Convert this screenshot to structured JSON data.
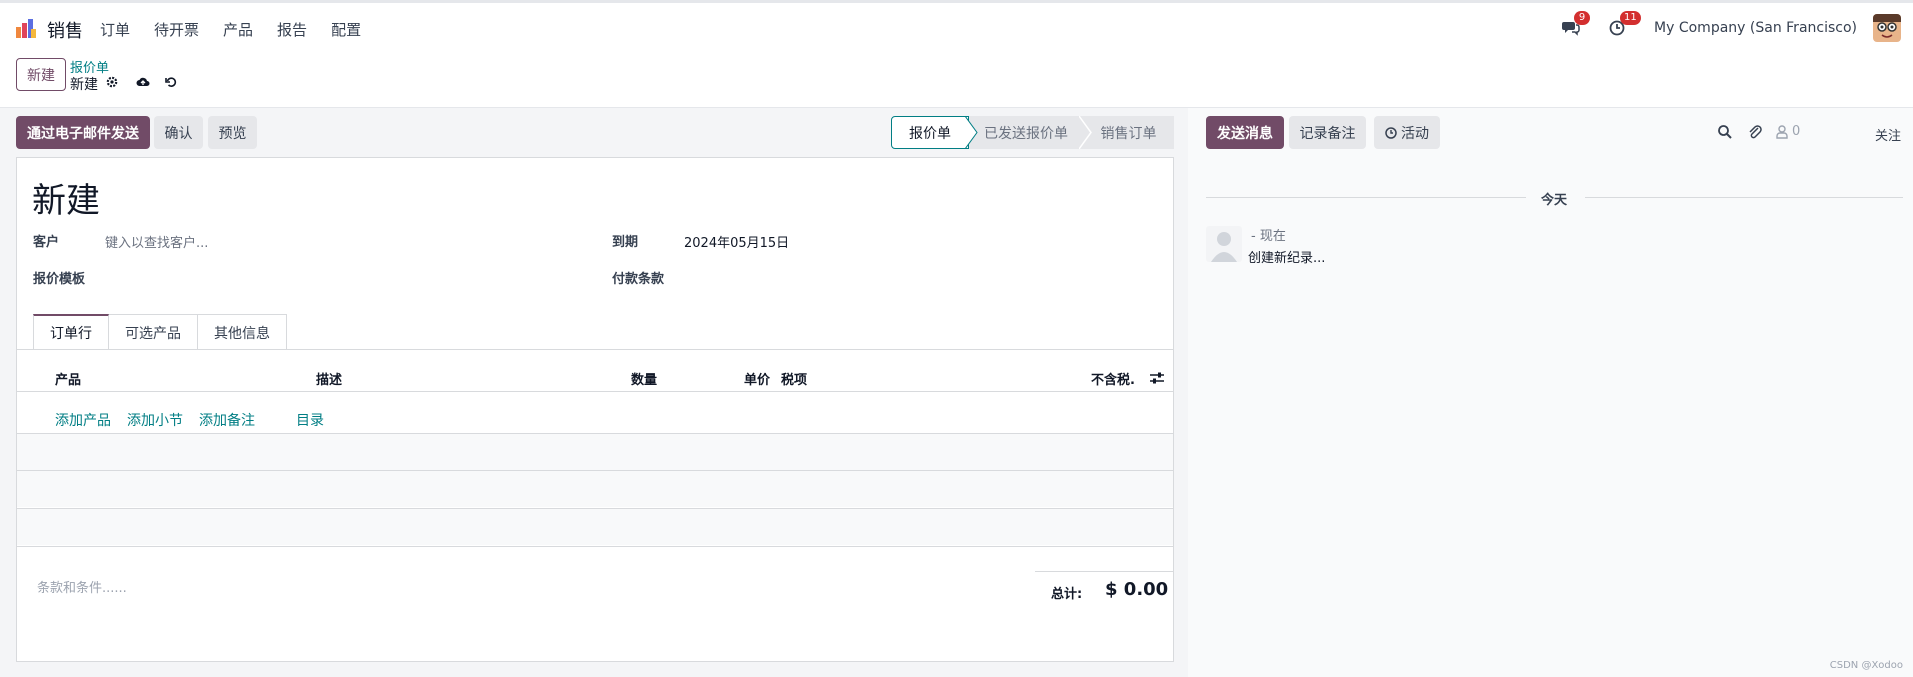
{
  "topbar": {
    "app_name": "销售",
    "menu": [
      "订单",
      "待开票",
      "产品",
      "报告",
      "配置"
    ],
    "messages_badge": "9",
    "activities_badge": "11",
    "company": "My Company (San Francisco)"
  },
  "control_panel": {
    "new_button": "新建",
    "breadcrumb_parent": "报价单",
    "breadcrumb_current": "新建"
  },
  "actions": {
    "send_email": "通过电子邮件发送",
    "confirm": "确认",
    "preview": "预览"
  },
  "status": {
    "stages": [
      "报价单",
      "已发送报价单",
      "销售订单"
    ],
    "active_index": 0
  },
  "form": {
    "title": "新建",
    "customer_label": "客户",
    "customer_placeholder": "键入以查找客户...",
    "template_label": "报价模板",
    "expiration_label": "到期",
    "expiration_value": "2024年05月15日",
    "payment_terms_label": "付款条款",
    "tabs": [
      "订单行",
      "可选产品",
      "其他信息"
    ],
    "columns": {
      "product": "产品",
      "description": "描述",
      "quantity": "数量",
      "unit_price": "单价",
      "taxes": "税项",
      "subtotal": "不含税."
    },
    "add_links": [
      "添加产品",
      "添加小节",
      "添加备注",
      "目录"
    ],
    "terms_placeholder": "条款和条件......",
    "total_label": "总计:",
    "total_value": "$ 0.00"
  },
  "chatter": {
    "send_message": "发送消息",
    "log_note": "记录备注",
    "activity": "活动",
    "followers_count": "0",
    "follow": "关注",
    "today": "今天",
    "message_time": "- 现在",
    "message_body": "创建新纪录..."
  },
  "watermark": "CSDN @Xodoo",
  "colors": {
    "brand": "#714b67",
    "link": "#017e84",
    "badge": "#d32f2f"
  }
}
